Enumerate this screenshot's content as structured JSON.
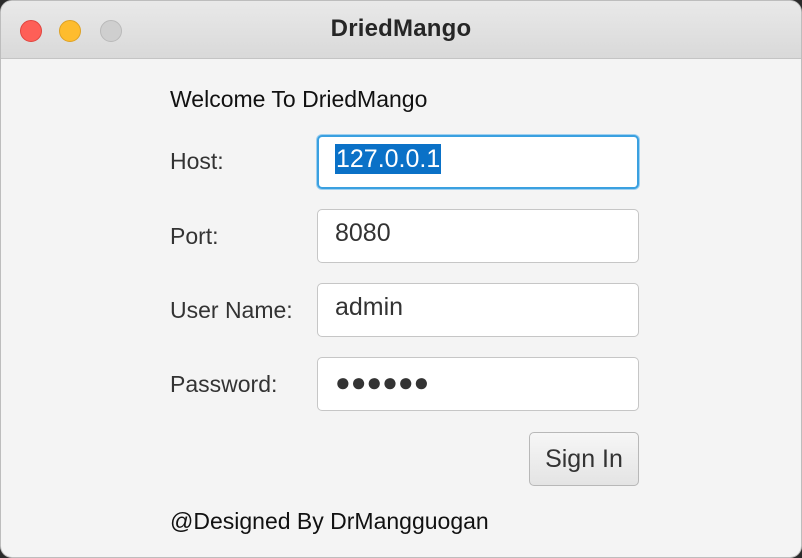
{
  "window": {
    "title": "DriedMango"
  },
  "form": {
    "welcome": "Welcome To DriedMango",
    "host_label": "Host:",
    "host_value": "127.0.0.1",
    "port_label": "Port:",
    "port_value": "8080",
    "username_label": "User Name:",
    "username_value": "admin",
    "password_label": "Password:",
    "password_masked": "●●●●●●",
    "signin_label": "Sign In"
  },
  "footer": {
    "text": "@Designed By DrMangguogan"
  },
  "colors": {
    "close": "#fe5f57",
    "minimize": "#febc2e",
    "maximize_disabled": "#cfcfcf",
    "focus_ring": "#3aa0e0",
    "selection": "#0a71c7"
  }
}
